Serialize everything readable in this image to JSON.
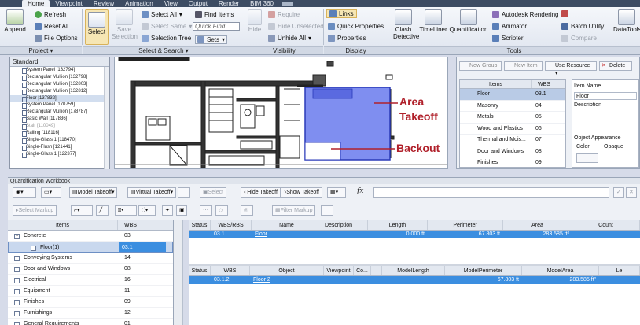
{
  "tabs": [
    "Home",
    "Viewpoint",
    "Review",
    "Animation",
    "View",
    "Output",
    "Render",
    "BIM 360"
  ],
  "ribbon": {
    "append": "Append",
    "refresh": "Refresh",
    "reset_all": "Reset All...",
    "file_options": "File Options",
    "select": "Select",
    "save_selection": "Save Selection",
    "select_all": "Select All",
    "select_same": "Select Same",
    "selection_tree": "Selection Tree",
    "find_items": "Find Items",
    "quick_find": "Quick Find",
    "sets": "Sets",
    "hide": "Hide",
    "require": "Require",
    "hide_unselected": "Hide Unselected",
    "unhide_all": "Unhide All",
    "links": "Links",
    "quick_properties": "Quick Properties",
    "properties": "Properties",
    "clash_detective": "Clash Detective",
    "timeliner": "TimeLiner",
    "quantification": "Quantification",
    "autodesk_rendering": "Autodesk Rendering",
    "animator": "Animator",
    "scripter": "Scripter",
    "batch_utility": "Batch Utility",
    "compare": "Compare",
    "datatools": "DataTools",
    "panels": [
      "Project",
      "Select & Search",
      "Visibility",
      "Display",
      "Tools"
    ]
  },
  "left_pane": {
    "header": "Standard",
    "items": [
      {
        "label": "System Panel [132794]",
        "state": "normal"
      },
      {
        "label": "Rectangular Mullion [132798]",
        "state": "normal"
      },
      {
        "label": "Rectangular Mullion [132803]",
        "state": "normal"
      },
      {
        "label": "Rectangular Mullion [132812]",
        "state": "normal"
      },
      {
        "label": "Floor [137832]",
        "state": "selected"
      },
      {
        "label": "System Panel [170759]",
        "state": "normal"
      },
      {
        "label": "Rectangular Mullion [178787]",
        "state": "normal"
      },
      {
        "label": "Basic Wall [117836]",
        "state": "normal"
      },
      {
        "label": "Stair [110049]",
        "state": "dim"
      },
      {
        "label": "Railing [118116]",
        "state": "normal"
      },
      {
        "label": "Single-Glass 1 [118470]",
        "state": "normal"
      },
      {
        "label": "Single-Flush [121441]",
        "state": "normal"
      },
      {
        "label": "Single-Glass 1 [122377]",
        "state": "normal"
      }
    ]
  },
  "viewport": {
    "annotation_area": "Area",
    "annotation_takeoff": "Takeoff",
    "annotation_backout": "Backout",
    "accent": "#7f8ef0"
  },
  "resource_pane": {
    "toolbar": {
      "new_group": "New Group",
      "new_item": "New Item",
      "use_resource": "Use Resource",
      "delete": "Delete"
    },
    "columns": [
      "Items",
      "WBS"
    ],
    "rows": [
      {
        "name": "Floor",
        "wbs": "03.1",
        "sel": true
      },
      {
        "name": "Masonry",
        "wbs": "04",
        "sel": false
      },
      {
        "name": "Metals",
        "wbs": "05",
        "sel": false
      },
      {
        "name": "Wood and Plastics",
        "wbs": "06",
        "sel": false
      },
      {
        "name": "Thermal and Mois...",
        "wbs": "07",
        "sel": false
      },
      {
        "name": "Door and Windows",
        "wbs": "08",
        "sel": false
      },
      {
        "name": "Finishes",
        "wbs": "09",
        "sel": false
      }
    ],
    "properties": {
      "item_name_label": "Item Name",
      "item_name_value": "Floor",
      "description_label": "Description",
      "appearance_label": "Object Appearance",
      "color_label": "Color",
      "opaque_label": "Opaque"
    }
  },
  "workbook": {
    "title": "Quantification Workbook",
    "toolbar": {
      "model_takeoff": "Model Takeoff",
      "virtual_takeoff": "Virtual Takeoff",
      "select": "Select",
      "hide_takeoff": "Hide Takeoff",
      "show_takeoff": "Show Takeoff",
      "select_markup": "Select Markup",
      "filter_markup": "Filter Markup",
      "fx": "fx"
    },
    "items_columns": [
      "Items",
      "WBS"
    ],
    "items": [
      {
        "name": "Concrete",
        "wbs": "03",
        "level": 0,
        "state": "normal"
      },
      {
        "name": "Floor(1)",
        "wbs": "03.1",
        "level": 1,
        "state": "selected"
      },
      {
        "name": "Conveying Systems",
        "wbs": "14",
        "level": 0,
        "state": "normal"
      },
      {
        "name": "Door and Windows",
        "wbs": "08",
        "level": 0,
        "state": "normal"
      },
      {
        "name": "Electrical",
        "wbs": "16",
        "level": 0,
        "state": "normal"
      },
      {
        "name": "Equipment",
        "wbs": "11",
        "level": 0,
        "state": "normal"
      },
      {
        "name": "Finishes",
        "wbs": "09",
        "level": 0,
        "state": "normal"
      },
      {
        "name": "Furnishings",
        "wbs": "12",
        "level": 0,
        "state": "normal"
      },
      {
        "name": "General Requirements",
        "wbs": "01",
        "level": 0,
        "state": "normal"
      }
    ],
    "table1": {
      "columns": [
        "Status",
        "WBS/RBS",
        "Name",
        "Description",
        "",
        "Length",
        "Perimeter",
        "Area",
        "Count"
      ],
      "row": {
        "status": "",
        "wbs": "03.1",
        "name": "Floor",
        "description": "",
        "length": "0.000 ft",
        "perimeter": "67.803 ft",
        "area": "283.585 ft²",
        "count": ""
      }
    },
    "table2": {
      "columns": [
        "Status",
        "WBS",
        "Object",
        "Viewpoint",
        "Co...",
        "",
        "ModelLength",
        "ModelPerimeter",
        "ModelArea",
        "Le"
      ],
      "row": {
        "status": "",
        "wbs": "03.1.2",
        "object": "Floor 2",
        "viewpoint": "",
        "co": "",
        "length": "",
        "perimeter": "67.803 ft",
        "area": "283.585 ft²",
        "le": ""
      }
    }
  }
}
